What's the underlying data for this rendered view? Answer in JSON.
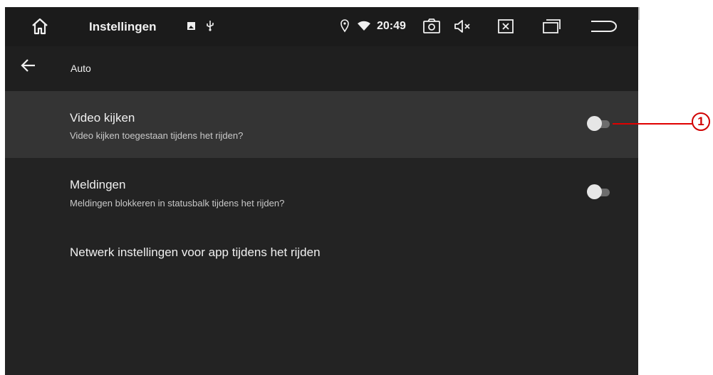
{
  "statusbar": {
    "app_title": "Instellingen",
    "clock": "20:49",
    "icons": [
      "home-icon",
      "notification-image-icon",
      "usb-icon",
      "location-icon",
      "wifi-icon",
      "screenshot-icon",
      "volume-muted-icon",
      "close-app-icon",
      "recent-apps-icon",
      "back-return-icon"
    ]
  },
  "header": {
    "title": "Auto"
  },
  "settings": [
    {
      "title": "Video kijken",
      "subtitle": "Video kijken toegestaan tijdens het rijden?",
      "toggle_on": false
    },
    {
      "title": "Meldingen",
      "subtitle": "Meldingen blokkeren in statusbalk tijdens het rijden?",
      "toggle_on": false
    },
    {
      "title": "Netwerk instellingen voor app tijdens het rijden"
    }
  ],
  "annotation": {
    "label": "1",
    "color": "#e00000"
  },
  "colors": {
    "background": "#232323",
    "statusbar": "#1b1b1b",
    "highlight_row": "#343434",
    "text": "#f0f0f0",
    "subtext": "#c9c9c9"
  }
}
